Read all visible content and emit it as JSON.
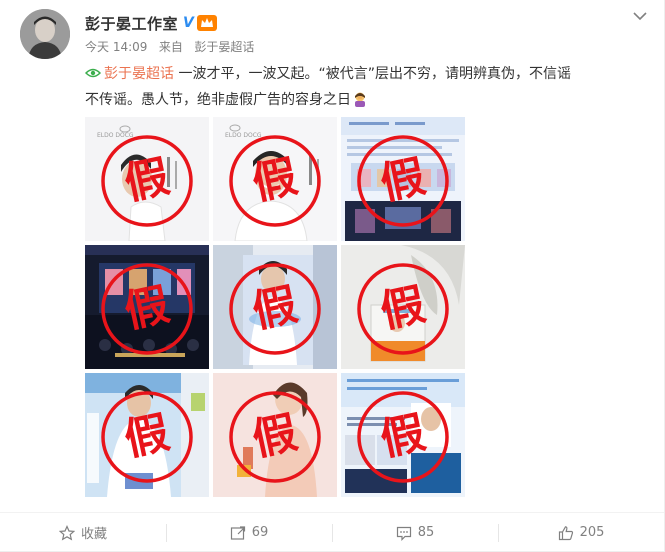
{
  "author": {
    "name": "彭于晏工作室",
    "verified_mark": "V"
  },
  "meta": {
    "time": "今天 14:09",
    "from_label": "来自",
    "source": "彭于晏超话"
  },
  "post": {
    "topic": "彭于晏超话",
    "text_line1": " 一波才平，一波又起。“被代言”层出不穷，请明辨真伪，不信谣",
    "text_line2": "不传谣。愚人节，绝非虚假广告的容身之日"
  },
  "images": {
    "stamp_char": "假",
    "brand_text": "ELDO DOCG",
    "items": [
      "thumb-1",
      "thumb-2",
      "thumb-3",
      "thumb-4",
      "thumb-5",
      "thumb-6",
      "thumb-7",
      "thumb-8",
      "thumb-9"
    ]
  },
  "actions": {
    "favorite_label": "收藏",
    "repost_count": "69",
    "comment_count": "85",
    "like_count": "205"
  },
  "colors": {
    "topic": "#eb7350",
    "stamp_red": "#e8141a",
    "vip": "#ff8200",
    "verify_blue": "#2d8cf0"
  },
  "icons": {
    "chevron": "chevron-down-icon",
    "topic": "topic-icon",
    "favorite": "star-icon",
    "repost": "repost-icon",
    "comment": "comment-icon",
    "like": "thumbs-up-icon",
    "emoji": "facepalm-emoji"
  }
}
